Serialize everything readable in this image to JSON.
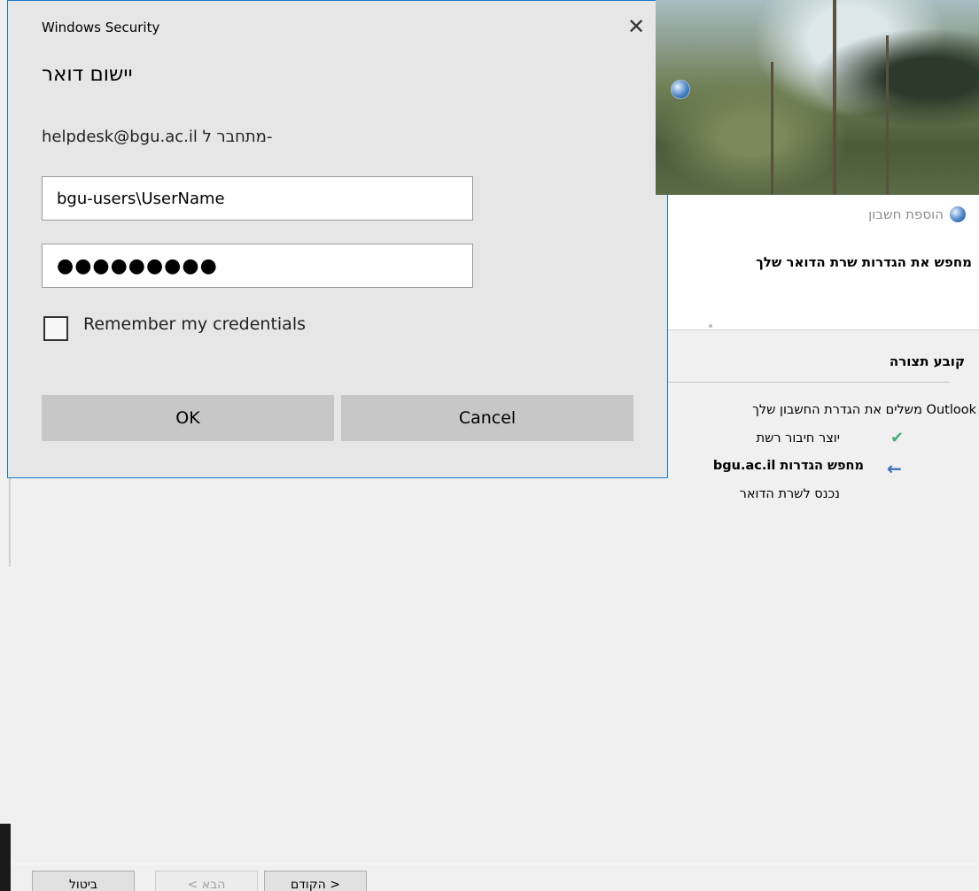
{
  "wizard": {
    "header_title": "הוספת חשבון",
    "header_subtitle": "מחפש את הגדרות שרת הדואר שלך",
    "config_title": "קובע תצורה",
    "config_message": "Outlook משלים את הגדרת החשבון שלך",
    "steps": [
      {
        "label": "יוצר חיבור רשת",
        "status": "done",
        "icon": "check-icon"
      },
      {
        "label": "מחפש הגדרות bgu.ac.il",
        "status": "current",
        "icon": "arrow-left-icon"
      },
      {
        "label": "נכנס לשרת הדואר",
        "status": "pending",
        "icon": ""
      }
    ],
    "buttons": {
      "cancel": "ביטול",
      "next": "הבא >",
      "back": "< הקודם"
    }
  },
  "dialog": {
    "window_title": "Windows Security",
    "close_glyph": "✕",
    "heading": "יישום דואר",
    "connecting_to": "helpdesk@bgu.ac.il מתחבר ל-",
    "username_value": "bgu-users\\UserName",
    "password_mask": "●●●●●●●●●",
    "remember_label": "Remember my credentials",
    "remember_checked": false,
    "ok_label": "OK",
    "cancel_label": "Cancel"
  },
  "colors": {
    "dialog_border": "#1979ca",
    "dialog_bg": "#e6e6e6",
    "button_bg": "#c7c7c7",
    "check_green": "#4caf7a",
    "arrow_blue": "#3d6fb6"
  }
}
